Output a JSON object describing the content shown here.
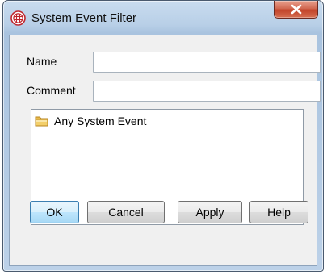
{
  "window": {
    "title": "System Event Filter"
  },
  "form": {
    "name_label": "Name",
    "name_value": "",
    "comment_label": "Comment",
    "comment_value": ""
  },
  "tree": {
    "items": [
      {
        "label": "Any System Event",
        "icon": "folder-icon"
      }
    ]
  },
  "buttons": {
    "ok": "OK",
    "cancel": "Cancel",
    "apply": "Apply",
    "help": "Help"
  },
  "colors": {
    "title_bar": "#b8cfe7",
    "close_button": "#c2432a",
    "default_button": "#bee6fd"
  }
}
